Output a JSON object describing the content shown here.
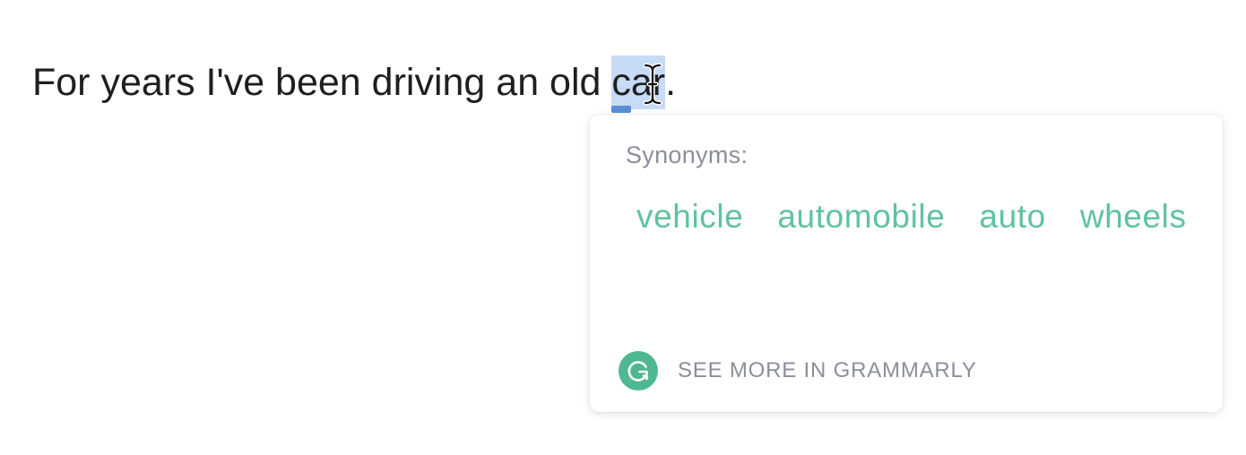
{
  "document": {
    "text_before": "For years I've been driving an old ",
    "selected_word": "car",
    "text_after": "."
  },
  "synonym_popup": {
    "heading": "Synonyms:",
    "synonyms": [
      "vehicle",
      "automobile",
      "auto",
      "wheels"
    ],
    "footer_label": "SEE MORE IN GRAMMARLY",
    "accent_color": "#5fc2a0",
    "logo_color": "#4fb891"
  },
  "icons": {
    "cursor": "i-beam-cursor-icon",
    "logo": "grammarly-logo-icon"
  }
}
